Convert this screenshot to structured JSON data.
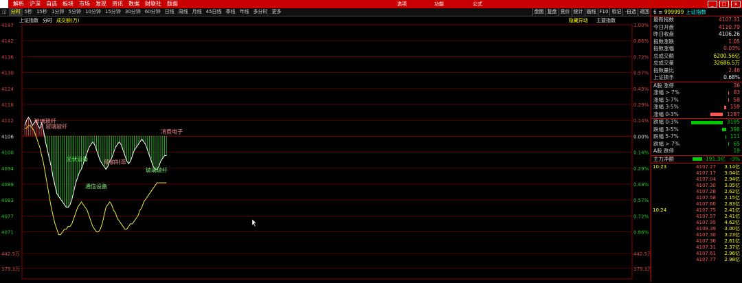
{
  "menubar": {
    "items": [
      "解析",
      "沪深",
      "自选",
      "板块",
      "市场",
      "发现",
      "资讯",
      "数据",
      "财联社",
      "版面"
    ],
    "center_items": [
      "选项",
      "功能",
      "公式"
    ]
  },
  "toolbar": {
    "items": [
      "分时",
      "5秒",
      "15秒",
      "1分钟",
      "5分钟",
      "10分钟",
      "15分钟",
      "30分钟",
      "60分钟",
      "日线",
      "周线",
      "月线",
      "45日线",
      "季线",
      "年线",
      "多分时",
      "更多"
    ],
    "right": [
      "盘面",
      "复盘",
      "竞价",
      "统计",
      "画线",
      "F10",
      "标记",
      "-自选",
      "返回"
    ]
  },
  "subbar": {
    "title": "上证指数",
    "tab": "分时",
    "vol": "成交额(万)",
    "right1": "隐藏异动",
    "right2": "主要指数"
  },
  "chart_data": {
    "type": "line",
    "title": "上证指数",
    "y_left_ticks": [
      "4147",
      "4142",
      "4136",
      "4130",
      "4124",
      "4118",
      "4112",
      "4106",
      "4100",
      "4094",
      "4089",
      "4083",
      "4077",
      "4071"
    ],
    "y_right_ticks": [
      "1.00%",
      "0.86%",
      "0.72%",
      "0.57%",
      "0.43%",
      "0.29%",
      "0.14%",
      "0.00%",
      "0.14%",
      "0.29%",
      "0.43%",
      "0.57%",
      "0.72%",
      "0.86%"
    ],
    "vol_ticks": [
      "442.5万",
      "379.3万"
    ],
    "prev_close": 4106.26,
    "price": [
      4110,
      4112,
      4113,
      4112,
      4110,
      4111,
      4112,
      4110,
      4109,
      4111,
      4108,
      4104,
      4101,
      4098,
      4095,
      4091,
      4088,
      4085,
      4084,
      4083,
      4082,
      4081,
      4080,
      4080,
      4081,
      4083,
      4086,
      4089,
      4091,
      4093,
      4094,
      4096,
      4098,
      4100,
      4102,
      4103,
      4104,
      4103,
      4101,
      4099,
      4097,
      4096,
      4095,
      4094,
      4095,
      4097,
      4098,
      4100,
      4102,
      4103,
      4104,
      4103,
      4101,
      4099,
      4097,
      4096,
      4097,
      4099,
      4101,
      4102,
      4103,
      4104,
      4105,
      4104,
      4103,
      4101,
      4099,
      4097,
      4095,
      4094,
      4094,
      4095,
      4097,
      4098,
      4099,
      4099
    ],
    "average": [
      4109,
      4109,
      4110,
      4110,
      4109,
      4108,
      4106,
      4104,
      4102,
      4099,
      4096,
      4092,
      4088,
      4084,
      4080,
      4077,
      4074,
      4072,
      4070,
      4070,
      4071,
      4072,
      4072,
      4073,
      4073,
      4074,
      4076,
      4078,
      4080,
      4081,
      4082,
      4081,
      4080,
      4079,
      4077,
      4075,
      4073,
      4072,
      4071,
      4071,
      4072,
      4074,
      4077,
      4080,
      4081,
      4082,
      4081,
      4079,
      4078,
      4076,
      4075,
      4074,
      4073,
      4072,
      4072,
      4073,
      4074,
      4074,
      4075,
      4076,
      4077,
      4079,
      4080,
      4082,
      4083,
      4084,
      4085,
      4086,
      4087,
      4088,
      4089,
      4089,
      4089,
      4089,
      4089,
      4089
    ],
    "annotations": [
      {
        "label": "玻璃玻纤",
        "color": "#e88"
      },
      {
        "label": "玻璃玻纤",
        "color": "#e88"
      },
      {
        "label": "光伏设备",
        "color": "#7e7"
      },
      {
        "label": "船舶制造",
        "color": "#e88"
      },
      {
        "label": "通信设备",
        "color": "#7e7"
      },
      {
        "label": "玻璃玻纤",
        "color": "#7e7"
      },
      {
        "label": "消费电子",
        "color": "#e88"
      }
    ]
  },
  "side": {
    "header_code": "999999",
    "header_name": "上证指数",
    "stats": [
      {
        "l": "最新指数",
        "r": "4107.31",
        "c": "#f55"
      },
      {
        "l": "今日开盘",
        "r": "4110.79",
        "c": "#f55"
      },
      {
        "l": "昨日收盘",
        "r": "4106.26",
        "c": "#eee"
      },
      {
        "l": "指数涨跌",
        "r": "1.05",
        "c": "#f55"
      },
      {
        "l": "指数涨幅",
        "r": "0.03%",
        "c": "#f55"
      },
      {
        "l": "总成交额",
        "r": "6200.56亿",
        "c": "#ff0"
      },
      {
        "l": "总成交量",
        "r": "32686.5万",
        "c": "#ff0"
      },
      {
        "l": "指数量比",
        "r": "2.46",
        "c": "#f55"
      },
      {
        "l": "上证换手",
        "r": "0.68%",
        "c": "#eee"
      }
    ],
    "ups": [
      {
        "l": "A股 涨停",
        "r": "36",
        "w": 0,
        "c": "#f55"
      },
      {
        "l": "涨幅 > 7%",
        "r": "83",
        "w": 1,
        "c": "#f55"
      },
      {
        "l": "涨幅 5-7%",
        "r": "58",
        "w": 1,
        "c": "#f55"
      },
      {
        "l": "涨幅 3-5%",
        "r": "159",
        "w": 3,
        "c": "#f55"
      },
      {
        "l": "涨幅 0-3%",
        "r": "1287",
        "w": 18,
        "c": "#f55"
      }
    ],
    "downs": [
      {
        "l": "跌幅 0-3%",
        "r": "3195",
        "w": 46,
        "c": "#0c0"
      },
      {
        "l": "跌幅 3-5%",
        "r": "398",
        "w": 6,
        "c": "#0c0"
      },
      {
        "l": "跌幅 5-7%",
        "r": "111",
        "w": 1,
        "c": "#0c0"
      },
      {
        "l": "跌幅 > 7%",
        "r": "65",
        "w": 1,
        "c": "#0c0"
      },
      {
        "l": "A股 跌停",
        "r": "19",
        "w": 0,
        "c": "#0c0"
      }
    ],
    "net_label": "主力净额",
    "net_value": "-191.3亿",
    "net_pct": "-3%",
    "ticks": [
      {
        "t": "10:23",
        "p": "4107.27",
        "v": "3.14亿"
      },
      {
        "t": "",
        "p": "4107.17",
        "v": "3.04亿"
      },
      {
        "t": "",
        "p": "4107.04",
        "v": "2.94亿"
      },
      {
        "t": "",
        "p": "4107.30",
        "v": "3.05亿"
      },
      {
        "t": "",
        "p": "4107.28",
        "v": "2.62亿"
      },
      {
        "t": "",
        "p": "4107.58",
        "v": "2.15亿"
      },
      {
        "t": "",
        "p": "4107.60",
        "v": "2.83亿"
      },
      {
        "t": "10:24",
        "p": "4107.75",
        "v": "2.41亿"
      },
      {
        "t": "",
        "p": "4107.57",
        "v": "2.41亿"
      },
      {
        "t": "",
        "p": "4107.95",
        "v": "4.62亿"
      },
      {
        "t": "",
        "p": "4108.39",
        "v": "3.00亿"
      },
      {
        "t": "",
        "p": "4107.30",
        "v": "3.23亿"
      },
      {
        "t": "",
        "p": "4107.36",
        "v": "2.61亿"
      },
      {
        "t": "",
        "p": "4107.31",
        "v": "2.37亿"
      },
      {
        "t": "",
        "p": "4107.61",
        "v": "2.96亿"
      },
      {
        "t": "",
        "p": "4107.77",
        "v": "2.98亿"
      }
    ]
  }
}
